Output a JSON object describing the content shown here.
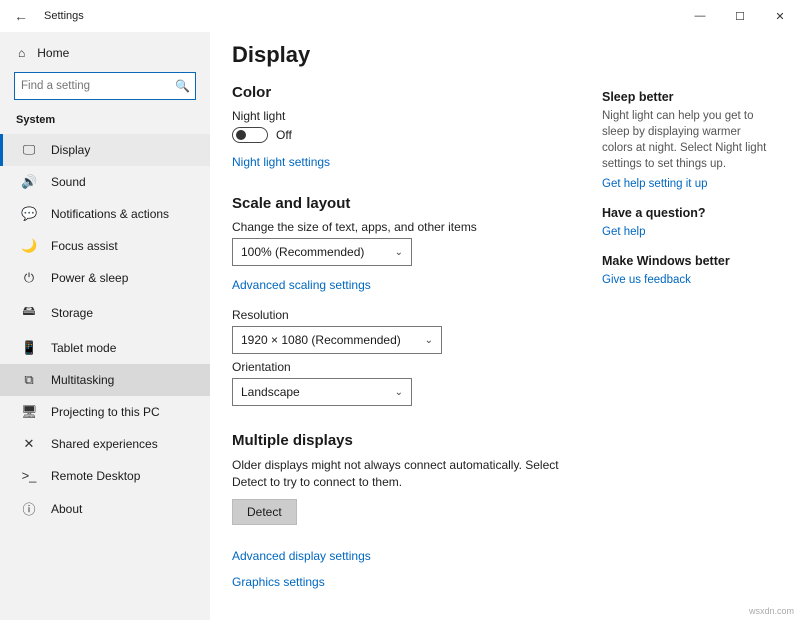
{
  "window": {
    "title": "Settings",
    "min": "—",
    "max": "☐",
    "close": "✕",
    "back": "←"
  },
  "sidebar": {
    "home": "Home",
    "search_placeholder": "Find a setting",
    "section": "System",
    "items": [
      {
        "icon": "🖵",
        "label": "Display",
        "active": true
      },
      {
        "icon": "🔊",
        "label": "Sound"
      },
      {
        "icon": "💬",
        "label": "Notifications & actions"
      },
      {
        "icon": "🌙",
        "label": "Focus assist"
      },
      {
        "icon": "⏻",
        "label": "Power & sleep"
      },
      {
        "icon": "🖴",
        "label": "Storage"
      },
      {
        "icon": "📱",
        "label": "Tablet mode"
      },
      {
        "icon": "⧉",
        "label": "Multitasking",
        "hover": true
      },
      {
        "icon": "🖥",
        "label": "Projecting to this PC"
      },
      {
        "icon": "✕",
        "label": "Shared experiences"
      },
      {
        "icon": ">_",
        "label": "Remote Desktop"
      },
      {
        "icon": "ⓘ",
        "label": "About"
      }
    ]
  },
  "page": {
    "title": "Display",
    "color_h": "Color",
    "night_light_label": "Night light",
    "night_light_state": "Off",
    "night_light_settings": "Night light settings",
    "scale_h": "Scale and layout",
    "scale_label": "Change the size of text, apps, and other items",
    "scale_value": "100% (Recommended)",
    "adv_scaling": "Advanced scaling settings",
    "resolution_label": "Resolution",
    "resolution_value": "1920 × 1080 (Recommended)",
    "orientation_label": "Orientation",
    "orientation_value": "Landscape",
    "multi_h": "Multiple displays",
    "multi_desc": "Older displays might not always connect automatically. Select Detect to try to connect to them.",
    "detect_btn": "Detect",
    "adv_display": "Advanced display settings",
    "graphics": "Graphics settings"
  },
  "right": {
    "sleep_h": "Sleep better",
    "sleep_text": "Night light can help you get to sleep by displaying warmer colors at night. Select Night light settings to set things up.",
    "sleep_link": "Get help setting it up",
    "q_h": "Have a question?",
    "q_link": "Get help",
    "fb_h": "Make Windows better",
    "fb_link": "Give us feedback"
  },
  "watermark": "wsxdn.com"
}
